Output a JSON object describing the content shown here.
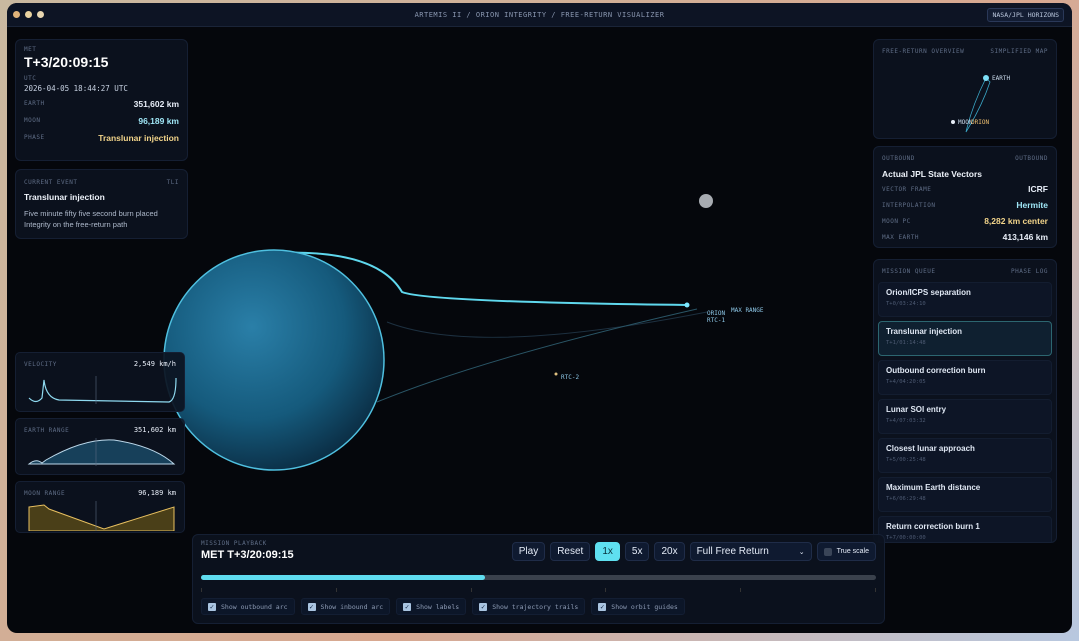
{
  "window": {
    "title": "ARTEMIS II / ORION INTEGRITY / FREE-RETURN VISUALIZER",
    "source_badge": "NASA/JPL HORIZONS"
  },
  "status": {
    "met_label": "MET",
    "met": "T+3/20:09:15",
    "utc_label": "UTC",
    "utc": "2026-04-05 18:44:27 UTC",
    "earth_label": "EARTH",
    "earth": "351,602 km",
    "moon_label": "MOON",
    "moon": "96,189 km",
    "phase_label": "PHASE",
    "phase": "Translunar injection"
  },
  "current_event": {
    "label": "CURRENT EVENT",
    "code": "TLI",
    "title": "Translunar injection",
    "desc": "Five minute fifty five second burn placed Integrity on the free-return path"
  },
  "sparklines": [
    {
      "label": "VELOCITY",
      "value": "2,549 km/h"
    },
    {
      "label": "EARTH RANGE",
      "value": "351,602 km"
    },
    {
      "label": "MOON RANGE",
      "value": "96,189 km"
    }
  ],
  "overview": {
    "label": "FREE-RETURN OVERVIEW",
    "tag": "SIMPLIFIED MAP",
    "earth": "EARTH",
    "moon": "MOON",
    "orion": "ORION"
  },
  "source": {
    "label": "OUTBOUND",
    "tag": "OUTBOUND",
    "title": "Actual JPL State Vectors",
    "rows": [
      {
        "k": "VECTOR FRAME",
        "v": "ICRF"
      },
      {
        "k": "INTERPOLATION",
        "v": "Hermite"
      },
      {
        "k": "MOON PC",
        "v": "8,282 km center"
      },
      {
        "k": "MAX EARTH",
        "v": "413,146 km"
      }
    ]
  },
  "queue": {
    "label": "MISSION QUEUE",
    "tag": "PHASE LOG",
    "events": [
      {
        "name": "Orion/ICPS separation",
        "time": "T+0/03:24:10"
      },
      {
        "name": "Translunar injection",
        "time": "T+1/01:14:48"
      },
      {
        "name": "Outbound correction burn",
        "time": "T+4/04:20:05"
      },
      {
        "name": "Lunar SOI entry",
        "time": "T+4/07:03:32"
      },
      {
        "name": "Closest lunar approach",
        "time": "T+5/00:25:48"
      },
      {
        "name": "Maximum Earth distance",
        "time": "T+6/06:29:48"
      },
      {
        "name": "Return correction burn 1",
        "time": "T+7/00:00:00"
      }
    ]
  },
  "scene": {
    "labels": {
      "orion": "ORION",
      "max_range": "MAX RANGE",
      "rtc1": "RTC-1",
      "rtc2": "RTC-2"
    }
  },
  "playback": {
    "label": "MISSION PLAYBACK",
    "met": "MET T+3/20:09:15",
    "play": "Play",
    "reset": "Reset",
    "speeds": [
      "1x",
      "5x",
      "20x"
    ],
    "active_speed": "1x",
    "mode": "Full Free Return",
    "true_scale": "True scale",
    "progress": 0.42,
    "toggles": [
      "Show outbound arc",
      "Show inbound arc",
      "Show labels",
      "Show trajectory trails",
      "Show orbit guides"
    ]
  }
}
